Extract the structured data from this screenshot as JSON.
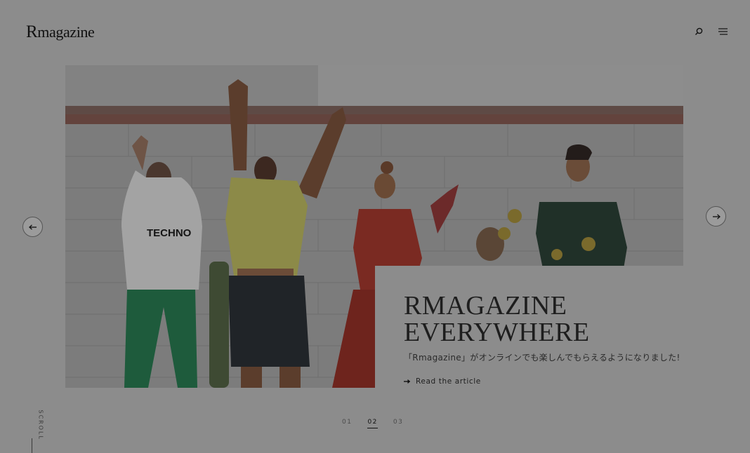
{
  "header": {
    "logo_r": "R",
    "logo_rest": "magazine"
  },
  "icons": {
    "search": "search-icon",
    "menu": "hamburger-menu-icon",
    "prev": "arrow-left-icon",
    "next": "arrow-right-icon",
    "link_arrow": "arrow-right-icon"
  },
  "hero": {
    "shirt_text": "TECHNO"
  },
  "card": {
    "title_line1": "RMAGAZINE",
    "title_line2": "EVERYWHERE",
    "subtitle": "「Rmagazine」がオンラインでも楽しんでもらえるようになりました!",
    "link_label": "Read the article"
  },
  "pager": {
    "items": [
      "01",
      "02",
      "03"
    ],
    "active_index": 1
  },
  "scroll": {
    "label": "SCROLL"
  },
  "colors": {
    "overlay_gray": "#8c8c8c",
    "text_dark": "#1e1e1e",
    "title_accent_red": "#8a2a1e",
    "title_accent_gold": "#a67a2a"
  }
}
